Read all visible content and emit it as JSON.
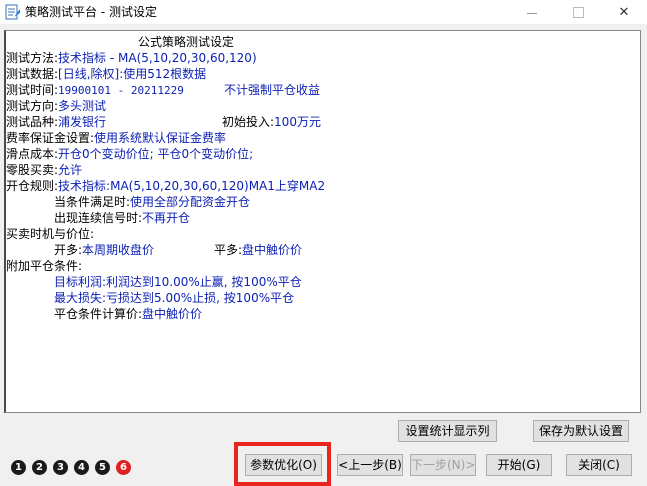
{
  "window": {
    "title": "策略测试平台 - 测试设定",
    "minimize": "—",
    "maximize": "□",
    "close": "✕"
  },
  "report": {
    "heading": "公式策略测试设定",
    "method_label": "测试方法:",
    "method_value": "技术指标 - MA(5,10,20,30,60,120)",
    "data_label": "测试数据:",
    "data_value": "[日线,除权]:使用512根数据",
    "time_label": "测试时间:",
    "time_value": "19900101 - 20211229",
    "time_note": "不计强制平仓收益",
    "direction_label": "测试方向:",
    "direction_value": "多头测试",
    "stock_label": "测试品种:",
    "stock_value": "浦发银行",
    "capital_label": "初始投入:",
    "capital_value": "100万元",
    "fee_label": "费率保证金设置:",
    "fee_value": "使用系统默认保证金费率",
    "slip_label": "滑点成本:",
    "slip_value": "开仓0个变动价位; 平仓0个变动价位;",
    "zero_label": "零股买卖:",
    "zero_value": "允许",
    "open_label": "开仓规则:",
    "open_value": "技术指标:MA(5,10,20,30,60,120)MA1上穿MA2",
    "cond_label": "当条件满足时:",
    "cond_value": "使用全部分配资金开仓",
    "consec_label": "出现连续信号时:",
    "consec_value": "不再开仓",
    "timing_label": "买卖时机与价位:",
    "long_open_label": "开多:",
    "long_open_value": "本周期收盘价",
    "long_close_label": "平多:",
    "long_close_value": "盘中触价价",
    "extra_label": "附加平仓条件:",
    "target_label": "目标利润:",
    "target_value": "利润达到10.00%止赢, 按100%平仓",
    "maxloss_label": "最大损失:",
    "maxloss_value": "亏损达到5.00%止损, 按100%平仓",
    "calc_label": "平仓条件计算价:",
    "calc_value": "盘中触价价"
  },
  "buttons": {
    "stats_columns": "设置统计显示列",
    "save_default": "保存为默认设置",
    "optimize": "参数优化(O)",
    "prev": "<上一步(B)",
    "next": "下一步(N)>",
    "start": "开始(G)",
    "close": "关闭(C)"
  },
  "steps": [
    "1",
    "2",
    "3",
    "4",
    "5",
    "6"
  ],
  "colors": {
    "value_text": "#0b1fb5",
    "highlight": "#e8261f",
    "active_step": "#e02020"
  }
}
